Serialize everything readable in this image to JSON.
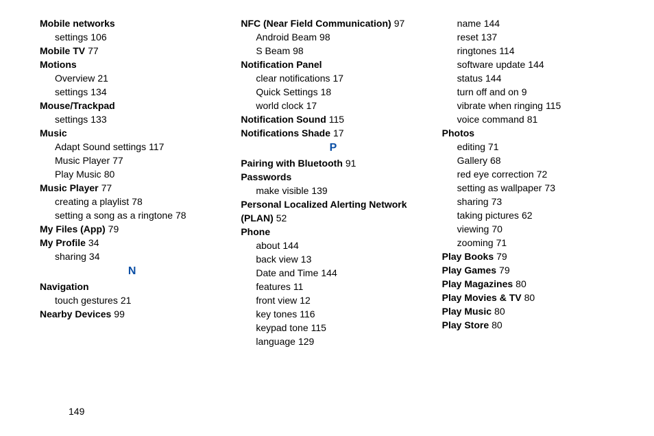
{
  "page_number": "149",
  "columns": [
    [
      {
        "type": "head",
        "text": "Mobile networks"
      },
      {
        "type": "sub",
        "text": "settings",
        "page": "106"
      },
      {
        "type": "headpg",
        "text": "Mobile TV",
        "page": "77"
      },
      {
        "type": "head",
        "text": "Motions"
      },
      {
        "type": "sub",
        "text": "Overview",
        "page": "21"
      },
      {
        "type": "sub",
        "text": "settings",
        "page": "134"
      },
      {
        "type": "head",
        "text": "Mouse/Trackpad"
      },
      {
        "type": "sub",
        "text": "settings",
        "page": "133"
      },
      {
        "type": "head",
        "text": "Music"
      },
      {
        "type": "sub",
        "text": "Adapt Sound settings",
        "page": "117"
      },
      {
        "type": "sub",
        "text": "Music Player",
        "page": "77"
      },
      {
        "type": "sub",
        "text": "Play Music",
        "page": "80"
      },
      {
        "type": "headpg",
        "text": "Music Player",
        "page": "77"
      },
      {
        "type": "sub",
        "text": "creating a playlist",
        "page": "78"
      },
      {
        "type": "sub",
        "text": "setting a song as a ringtone",
        "page": "78"
      },
      {
        "type": "headpg",
        "text": "My Files (App)",
        "page": "79"
      },
      {
        "type": "headpg",
        "text": "My Profile",
        "page": "34"
      },
      {
        "type": "sub",
        "text": "sharing",
        "page": "34"
      },
      {
        "type": "letter",
        "text": "N"
      },
      {
        "type": "head",
        "text": "Navigation"
      },
      {
        "type": "sub",
        "text": "touch gestures",
        "page": "21"
      },
      {
        "type": "headpg",
        "text": "Nearby Devices",
        "page": "99"
      }
    ],
    [
      {
        "type": "headpg",
        "text": "NFC (Near Field Communication)",
        "page": "97"
      },
      {
        "type": "sub",
        "text": "Android Beam",
        "page": "98"
      },
      {
        "type": "sub",
        "text": "S Beam",
        "page": "98"
      },
      {
        "type": "head",
        "text": "Notification Panel"
      },
      {
        "type": "sub",
        "text": "clear notifications",
        "page": "17"
      },
      {
        "type": "sub",
        "text": "Quick Settings",
        "page": "18"
      },
      {
        "type": "sub",
        "text": "world clock",
        "page": "17"
      },
      {
        "type": "headpg",
        "text": "Notification Sound",
        "page": "115"
      },
      {
        "type": "headpg",
        "text": "Notifications Shade",
        "page": "17"
      },
      {
        "type": "letter",
        "text": "P"
      },
      {
        "type": "headpg",
        "text": "Pairing with Bluetooth",
        "page": "91"
      },
      {
        "type": "head",
        "text": "Passwords"
      },
      {
        "type": "sub",
        "text": "make visible",
        "page": "139"
      },
      {
        "type": "headpg",
        "text": "Personal Localized Alerting Network (PLAN)",
        "page": "52"
      },
      {
        "type": "head",
        "text": "Phone"
      },
      {
        "type": "sub",
        "text": "about",
        "page": "144"
      },
      {
        "type": "sub",
        "text": "back view",
        "page": "13"
      },
      {
        "type": "sub",
        "text": "Date and Time",
        "page": "144"
      },
      {
        "type": "sub",
        "text": "features",
        "page": "11"
      },
      {
        "type": "sub",
        "text": "front view",
        "page": "12"
      },
      {
        "type": "sub",
        "text": "key tones",
        "page": "116"
      },
      {
        "type": "sub",
        "text": "keypad tone",
        "page": "115"
      },
      {
        "type": "sub",
        "text": "language",
        "page": "129"
      }
    ],
    [
      {
        "type": "sub",
        "text": "name",
        "page": "144"
      },
      {
        "type": "sub",
        "text": "reset",
        "page": "137"
      },
      {
        "type": "sub",
        "text": "ringtones",
        "page": "114"
      },
      {
        "type": "sub",
        "text": "software update",
        "page": "144"
      },
      {
        "type": "sub",
        "text": "status",
        "page": "144"
      },
      {
        "type": "sub",
        "text": "turn off and on",
        "page": "9"
      },
      {
        "type": "sub",
        "text": "vibrate when ringing",
        "page": "115"
      },
      {
        "type": "sub",
        "text": "voice command",
        "page": "81"
      },
      {
        "type": "head",
        "text": "Photos"
      },
      {
        "type": "sub",
        "text": "editing",
        "page": "71"
      },
      {
        "type": "sub",
        "text": "Gallery",
        "page": "68"
      },
      {
        "type": "sub",
        "text": "red eye correction",
        "page": "72"
      },
      {
        "type": "sub",
        "text": "setting as wallpaper",
        "page": "73"
      },
      {
        "type": "sub",
        "text": "sharing",
        "page": "73"
      },
      {
        "type": "sub",
        "text": "taking pictures",
        "page": "62"
      },
      {
        "type": "sub",
        "text": "viewing",
        "page": "70"
      },
      {
        "type": "sub",
        "text": "zooming",
        "page": "71"
      },
      {
        "type": "headpg",
        "text": "Play Books",
        "page": "79"
      },
      {
        "type": "headpg",
        "text": "Play Games",
        "page": "79"
      },
      {
        "type": "headpg",
        "text": "Play Magazines",
        "page": "80"
      },
      {
        "type": "headpg",
        "text": "Play Movies & TV",
        "page": "80"
      },
      {
        "type": "headpg",
        "text": "Play Music",
        "page": "80"
      },
      {
        "type": "headpg",
        "text": "Play Store",
        "page": "80"
      }
    ]
  ]
}
